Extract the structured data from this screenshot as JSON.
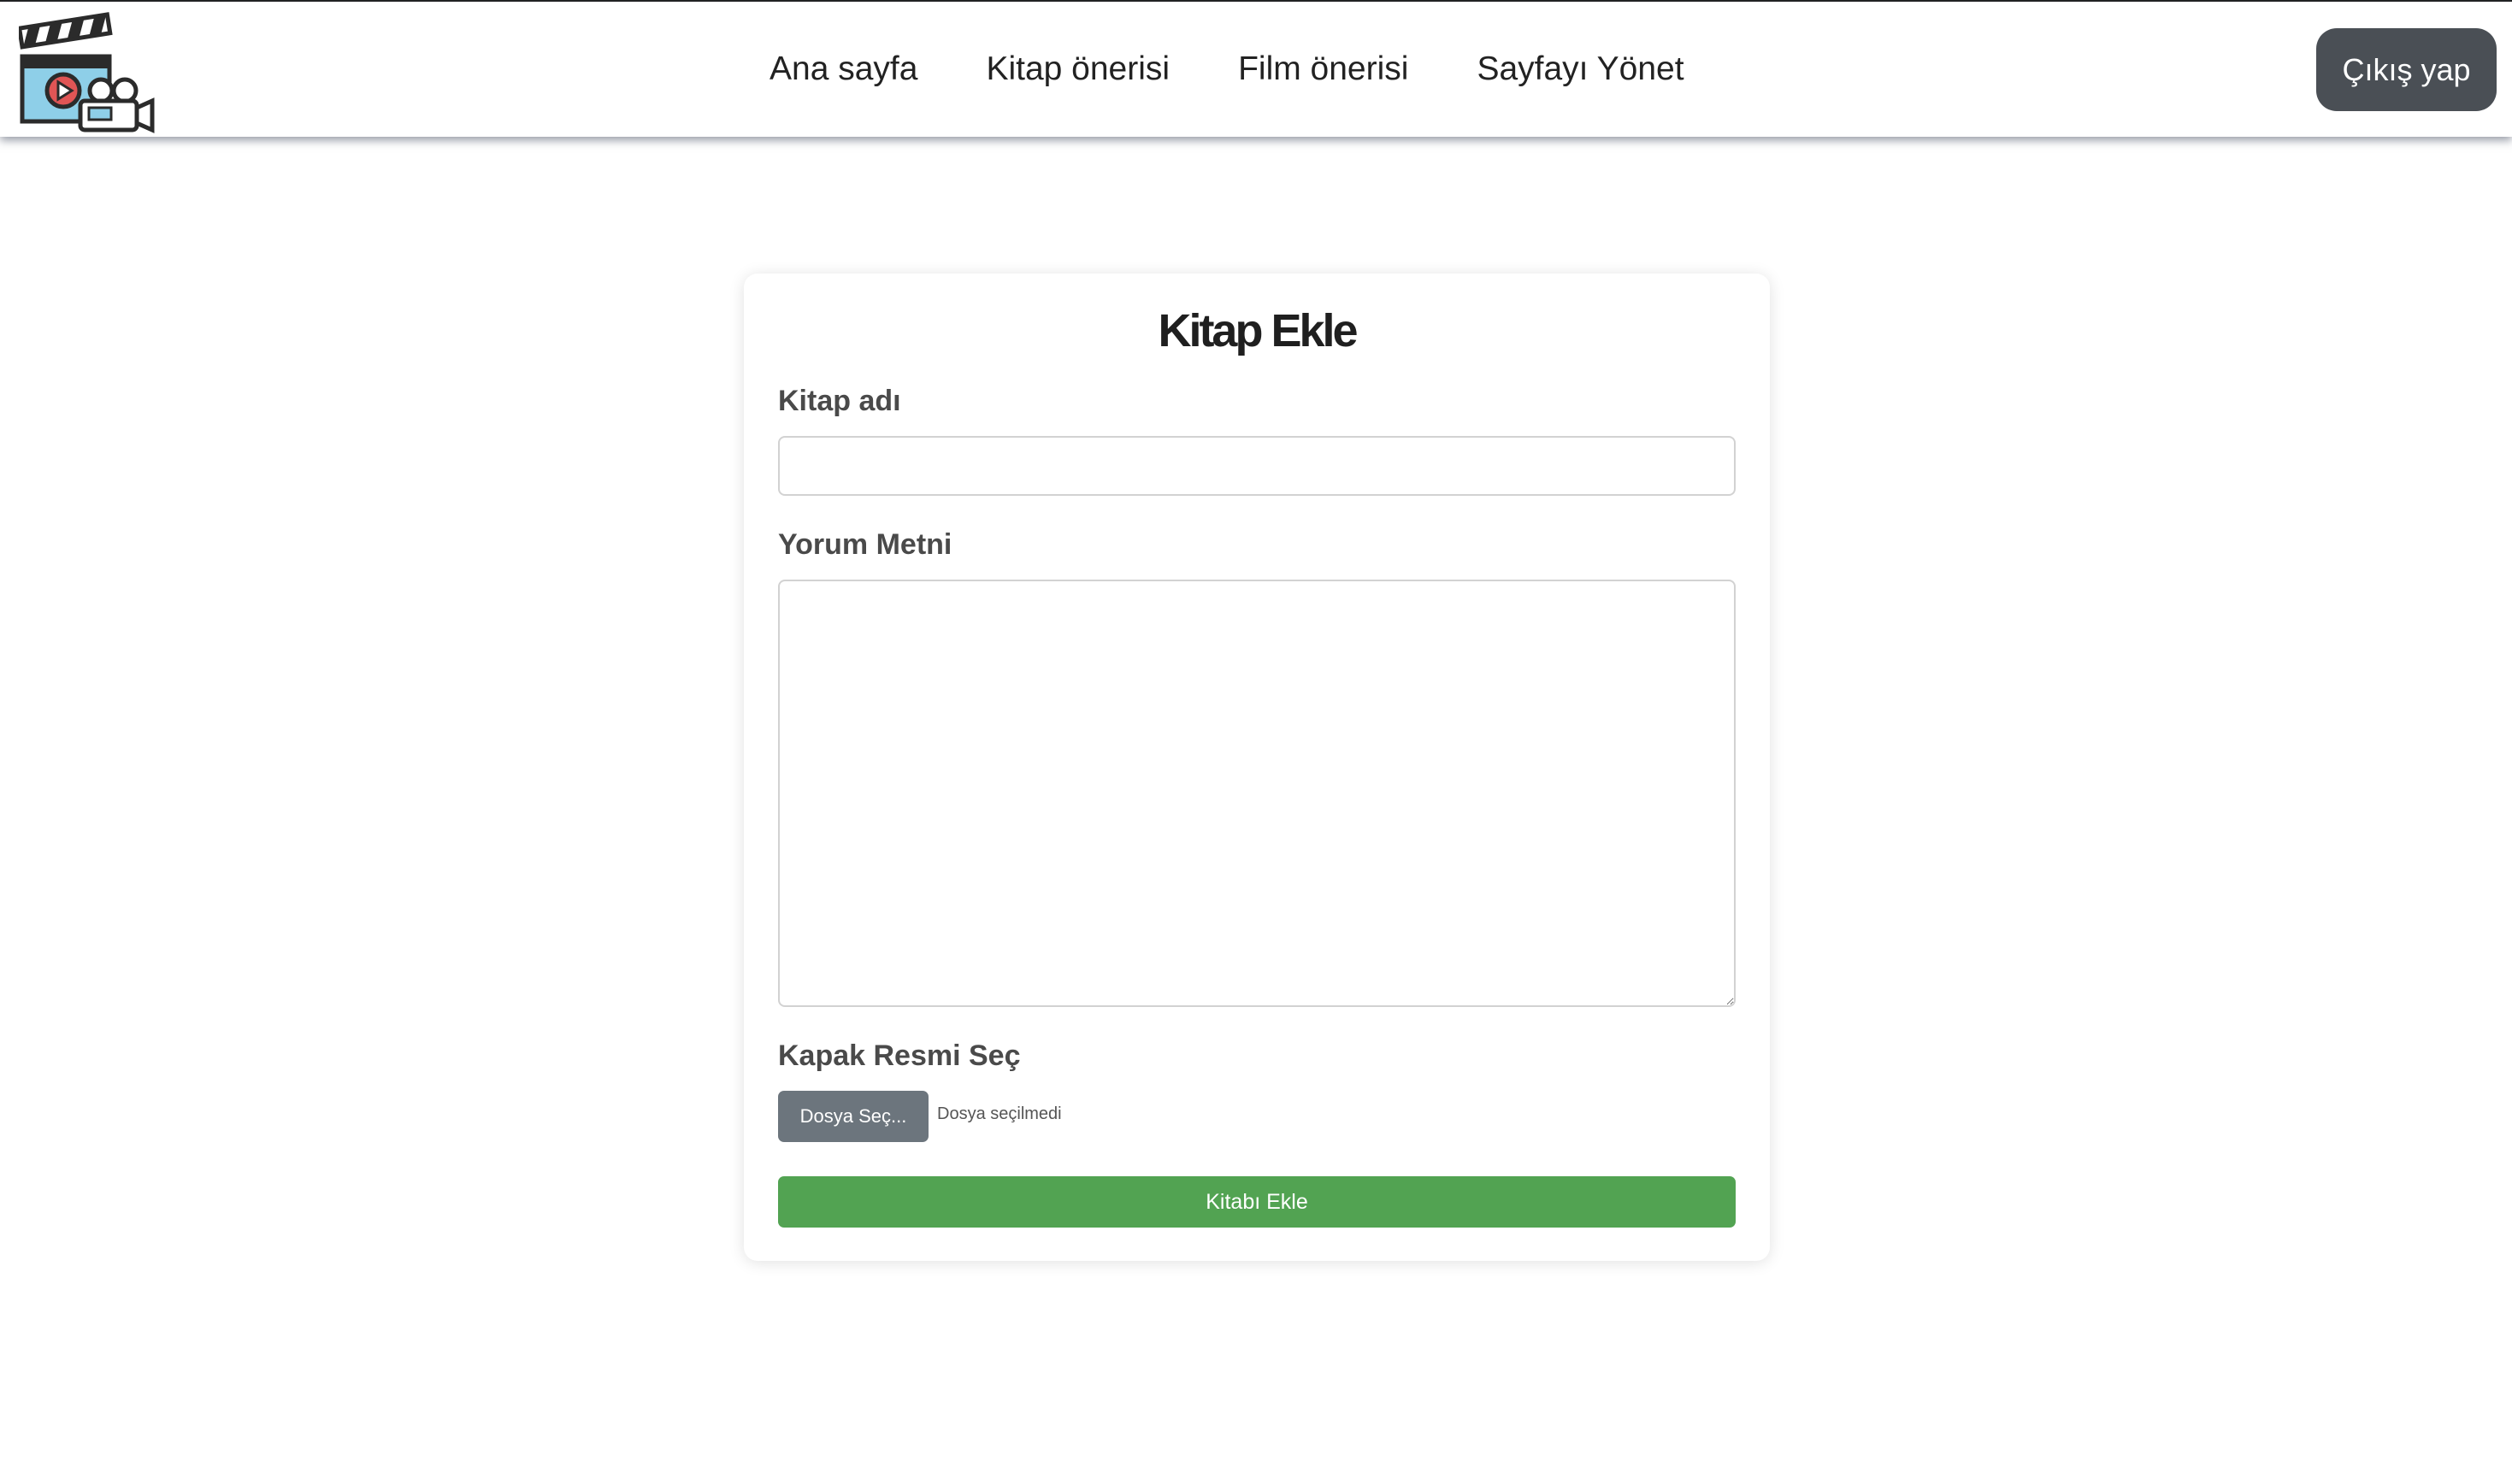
{
  "header": {
    "logo_icon": "film-clapperboard-camera-icon",
    "nav": [
      {
        "label": "Ana sayfa"
      },
      {
        "label": "Kitap önerisi"
      },
      {
        "label": "Film önerisi"
      },
      {
        "label": "Sayfayı Yönet"
      }
    ],
    "logout_label": "Çıkış yap"
  },
  "form": {
    "title": "Kitap Ekle",
    "book_name_label": "Kitap adı",
    "book_name_value": "",
    "review_label": "Yorum Metni",
    "review_value": "",
    "cover_label": "Kapak Resmi Seç",
    "file_button_label": "Dosya Seç...",
    "file_status": "Dosya seçilmedi",
    "submit_label": "Kitabı Ekle"
  },
  "colors": {
    "logout_bg": "#4a4f55",
    "file_button_bg": "#6c757d",
    "submit_bg": "#52a352",
    "card_bg": "#ffffff"
  }
}
